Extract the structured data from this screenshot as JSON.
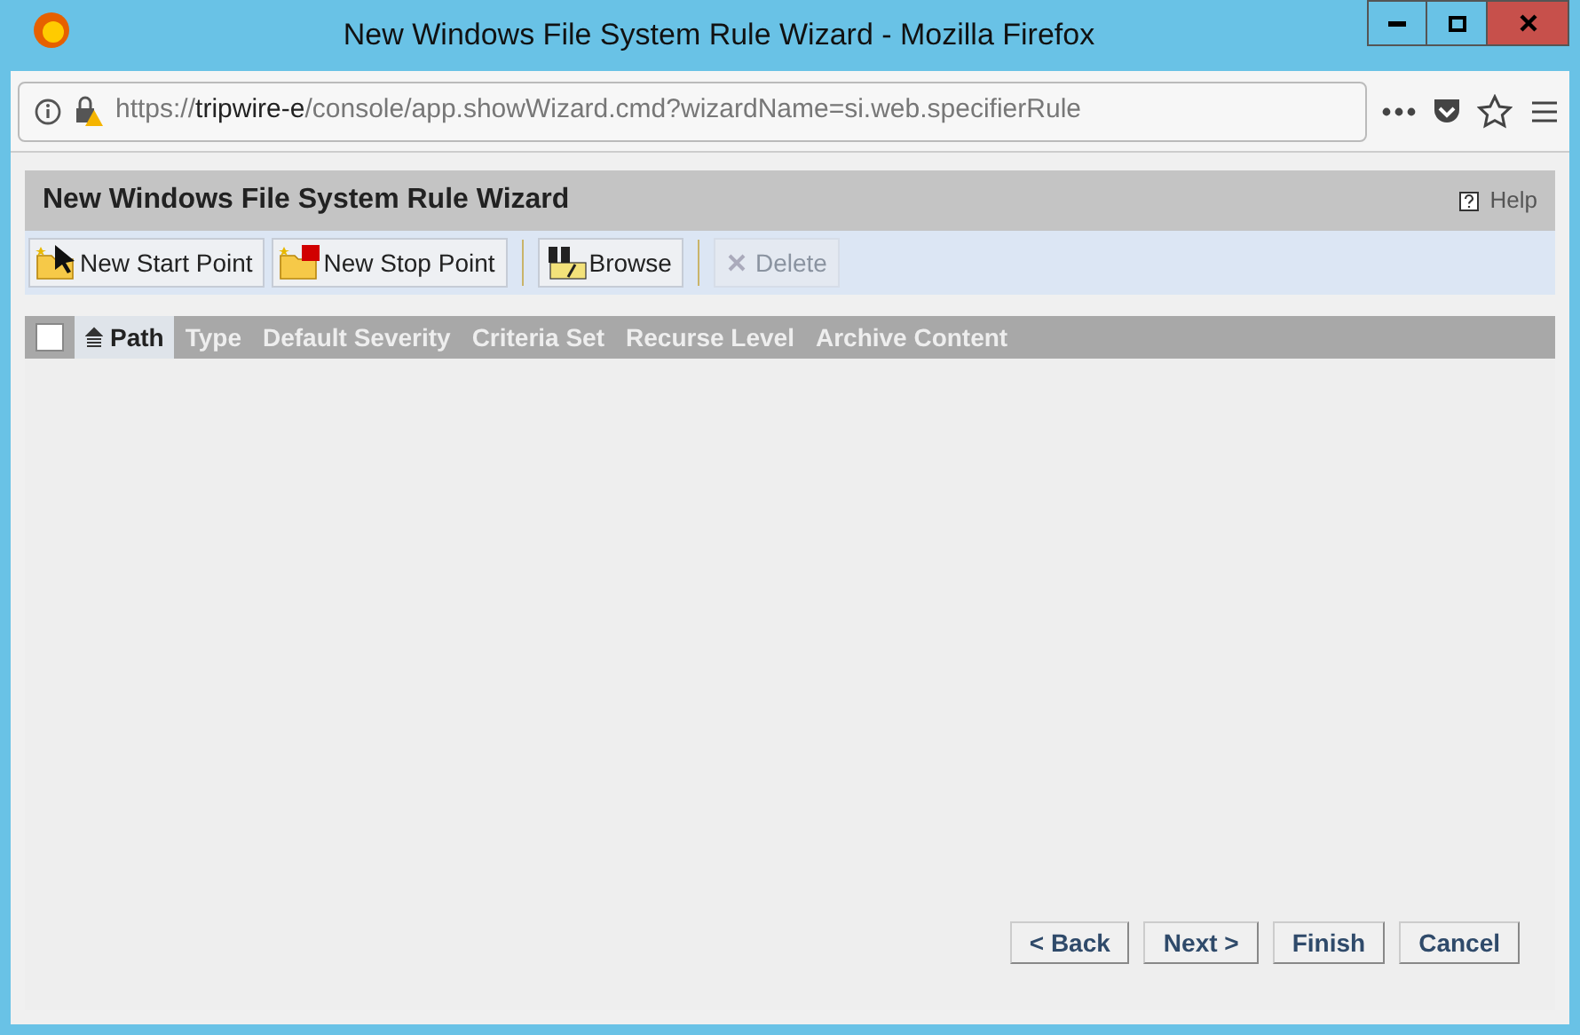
{
  "window": {
    "title": "New Windows File System Rule Wizard - Mozilla Firefox"
  },
  "address_bar": {
    "scheme": "https://",
    "host": "tripwire-e",
    "path": "/console/app.showWizard.cmd?wizardName=si.web.specifierRule"
  },
  "wizard": {
    "title": "New Windows File System Rule Wizard",
    "help": "Help"
  },
  "toolbar": [
    {
      "kind": "start",
      "label": "New Start Point",
      "disabled": false
    },
    {
      "kind": "stop",
      "label": "New Stop Point",
      "disabled": false
    },
    {
      "kind": "browse",
      "label": "Browse",
      "disabled": false
    },
    {
      "kind": "delete",
      "label": "Delete",
      "disabled": true
    }
  ],
  "table": {
    "select_all": {
      "checked": false
    },
    "columns": [
      {
        "label": "Path",
        "selected": true
      },
      {
        "label": "Type",
        "selected": false
      },
      {
        "label": "Default Severity",
        "selected": false
      },
      {
        "label": "Criteria Set",
        "selected": false
      },
      {
        "label": "Recurse Level",
        "selected": false
      },
      {
        "label": "Archive Content",
        "selected": false
      }
    ]
  },
  "buttons": [
    "< Back",
    "Next >",
    "Finish",
    "Cancel"
  ]
}
